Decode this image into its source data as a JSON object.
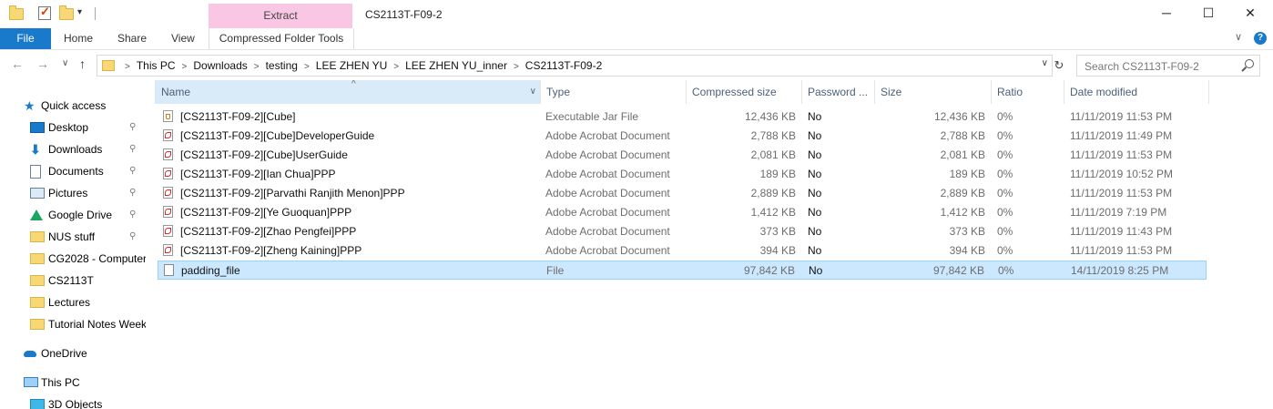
{
  "window": {
    "title": "CS2113T-F09-2",
    "extract_tab": "Extract",
    "minimize": "─",
    "maximize": "☐",
    "close": "✕"
  },
  "ribbon": {
    "file": "File",
    "tabs": [
      "Home",
      "Share",
      "View"
    ],
    "context_tab": "Compressed Folder Tools",
    "collapse": "∨",
    "help": "?"
  },
  "nav": {
    "back": "←",
    "forward": "→",
    "recent": "∨",
    "up": "↑",
    "breadcrumbs": [
      "This PC",
      "Downloads",
      "testing",
      "LEE ZHEN YU",
      "LEE ZHEN YU_inner",
      "CS2113T-F09-2"
    ],
    "sep": ">",
    "dropdown": "∨",
    "refresh": "↻",
    "search_placeholder": "Search CS2113T-F09-2"
  },
  "sidebar": {
    "pin": "📌",
    "items": [
      {
        "label": "Quick access",
        "icon": "star-icon"
      },
      {
        "label": "Desktop",
        "icon": "desktop-icon",
        "pinned": true
      },
      {
        "label": "Downloads",
        "icon": "download-icon",
        "pinned": true
      },
      {
        "label": "Documents",
        "icon": "documents-icon",
        "pinned": true
      },
      {
        "label": "Pictures",
        "icon": "pictures-icon",
        "pinned": true
      },
      {
        "label": "Google Drive",
        "icon": "google-drive-icon",
        "pinned": true
      },
      {
        "label": "NUS stuff",
        "icon": "folder-shortcut-icon",
        "pinned": true
      },
      {
        "label": "CG2028 - Computer",
        "icon": "folder-shortcut-icon"
      },
      {
        "label": "CS2113T",
        "icon": "folder-shortcut-icon"
      },
      {
        "label": "Lectures",
        "icon": "folder-shortcut-icon"
      },
      {
        "label": "Tutorial Notes Week",
        "icon": "folder-shortcut-icon"
      },
      {
        "label": "OneDrive",
        "icon": "onedrive-icon"
      },
      {
        "label": "This PC",
        "icon": "this-pc-icon"
      },
      {
        "label": "3D Objects",
        "icon": "3d-objects-icon"
      }
    ]
  },
  "columns": {
    "name": "Name",
    "type": "Type",
    "compressed_size": "Compressed size",
    "password": "Password ...",
    "size": "Size",
    "ratio": "Ratio",
    "date_modified": "Date modified",
    "sort_indicator": "^",
    "name_dropdown": "∨"
  },
  "files": [
    {
      "name": "[CS2113T-F09-2][Cube]",
      "type": "Executable Jar File",
      "compressed": "12,436 KB",
      "password": "No",
      "size": "12,436 KB",
      "ratio": "0%",
      "date": "11/11/2019 11:53 PM",
      "icon": "jar"
    },
    {
      "name": "[CS2113T-F09-2][Cube]DeveloperGuide",
      "type": "Adobe Acrobat Document",
      "compressed": "2,788 KB",
      "password": "No",
      "size": "2,788 KB",
      "ratio": "0%",
      "date": "11/11/2019 11:49 PM",
      "icon": "pdf"
    },
    {
      "name": "[CS2113T-F09-2][Cube]UserGuide",
      "type": "Adobe Acrobat Document",
      "compressed": "2,081 KB",
      "password": "No",
      "size": "2,081 KB",
      "ratio": "0%",
      "date": "11/11/2019 11:53 PM",
      "icon": "pdf"
    },
    {
      "name": "[CS2113T-F09-2][Ian Chua]PPP",
      "type": "Adobe Acrobat Document",
      "compressed": "189 KB",
      "password": "No",
      "size": "189 KB",
      "ratio": "0%",
      "date": "11/11/2019 10:52 PM",
      "icon": "pdf"
    },
    {
      "name": "[CS2113T-F09-2][Parvathi Ranjith Menon]PPP",
      "type": "Adobe Acrobat Document",
      "compressed": "2,889 KB",
      "password": "No",
      "size": "2,889 KB",
      "ratio": "0%",
      "date": "11/11/2019 11:53 PM",
      "icon": "pdf"
    },
    {
      "name": "[CS2113T-F09-2][Ye Guoquan]PPP",
      "type": "Adobe Acrobat Document",
      "compressed": "1,412 KB",
      "password": "No",
      "size": "1,412 KB",
      "ratio": "0%",
      "date": "11/11/2019 7:19 PM",
      "icon": "pdf"
    },
    {
      "name": "[CS2113T-F09-2][Zhao Pengfei]PPP",
      "type": "Adobe Acrobat Document",
      "compressed": "373 KB",
      "password": "No",
      "size": "373 KB",
      "ratio": "0%",
      "date": "11/11/2019 11:43 PM",
      "icon": "pdf"
    },
    {
      "name": "[CS2113T-F09-2][Zheng Kaining]PPP",
      "type": "Adobe Acrobat Document",
      "compressed": "394 KB",
      "password": "No",
      "size": "394 KB",
      "ratio": "0%",
      "date": "11/11/2019 11:53 PM",
      "icon": "pdf"
    },
    {
      "name": "padding_file",
      "type": "File",
      "compressed": "97,842 KB",
      "password": "No",
      "size": "97,842 KB",
      "ratio": "0%",
      "date": "14/11/2019 8:25 PM",
      "icon": "plain",
      "selected": true
    }
  ],
  "colors": {
    "accent": "#1979ca",
    "context_tab": "#f9c7e3",
    "selection": "#cce8ff"
  }
}
